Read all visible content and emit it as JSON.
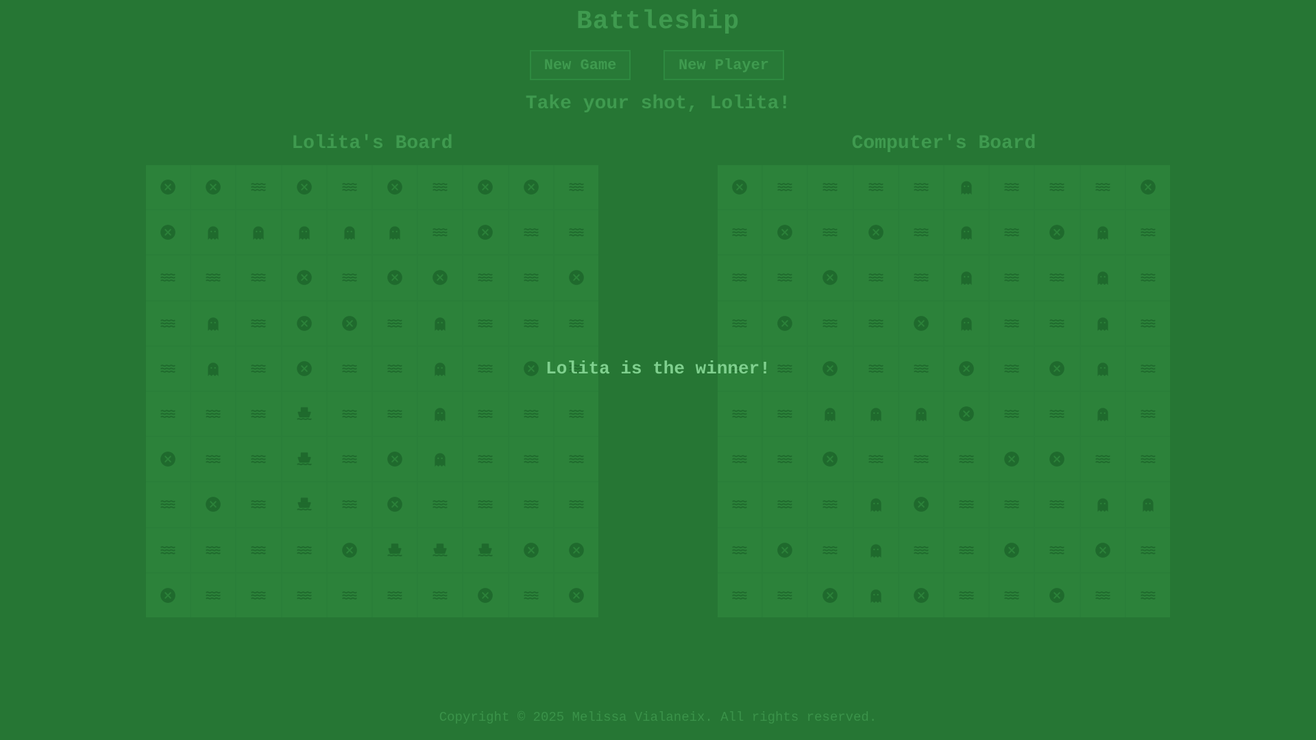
{
  "title": "Battleship",
  "buttons": {
    "new_game": "New Game",
    "new_player": "New Player"
  },
  "status": "Take your shot, Lolita!",
  "winner": "Lolita is the winner!",
  "footer": "Copyright © 2025 Melissa Vialaneix. All rights reserved.",
  "legend_icons": {
    "W": "water-icon",
    "M": "miss-icon",
    "H": "hit-icon",
    "S": "ship-icon"
  },
  "player_board": {
    "title": "Lolita's Board",
    "rows": [
      "MMWMWMWMMW",
      "MHHHHHWMWW",
      "WWWMWMMWWM",
      "WHWMMWHWWW",
      "WHWMWWHWMW",
      "WWWSWWHWWW",
      "MWWSWMHWWW",
      "WMWSWMWWWW",
      "WWWWMSSSMM",
      "MWWWWWWMWM"
    ]
  },
  "computer_board": {
    "title": "Computer's Board",
    "rows": [
      "MWWWWHWWWM",
      "WMWMWHWMHW",
      "WWMWWHWWHW",
      "WMWWMHWWHW",
      "WWMWWMWMHW",
      "WWHHHMWWHW",
      "WWMWWWMMWW",
      "WWWHMWWWHH",
      "WMWHWWMWMW",
      "WWMHMWWMWW"
    ]
  }
}
